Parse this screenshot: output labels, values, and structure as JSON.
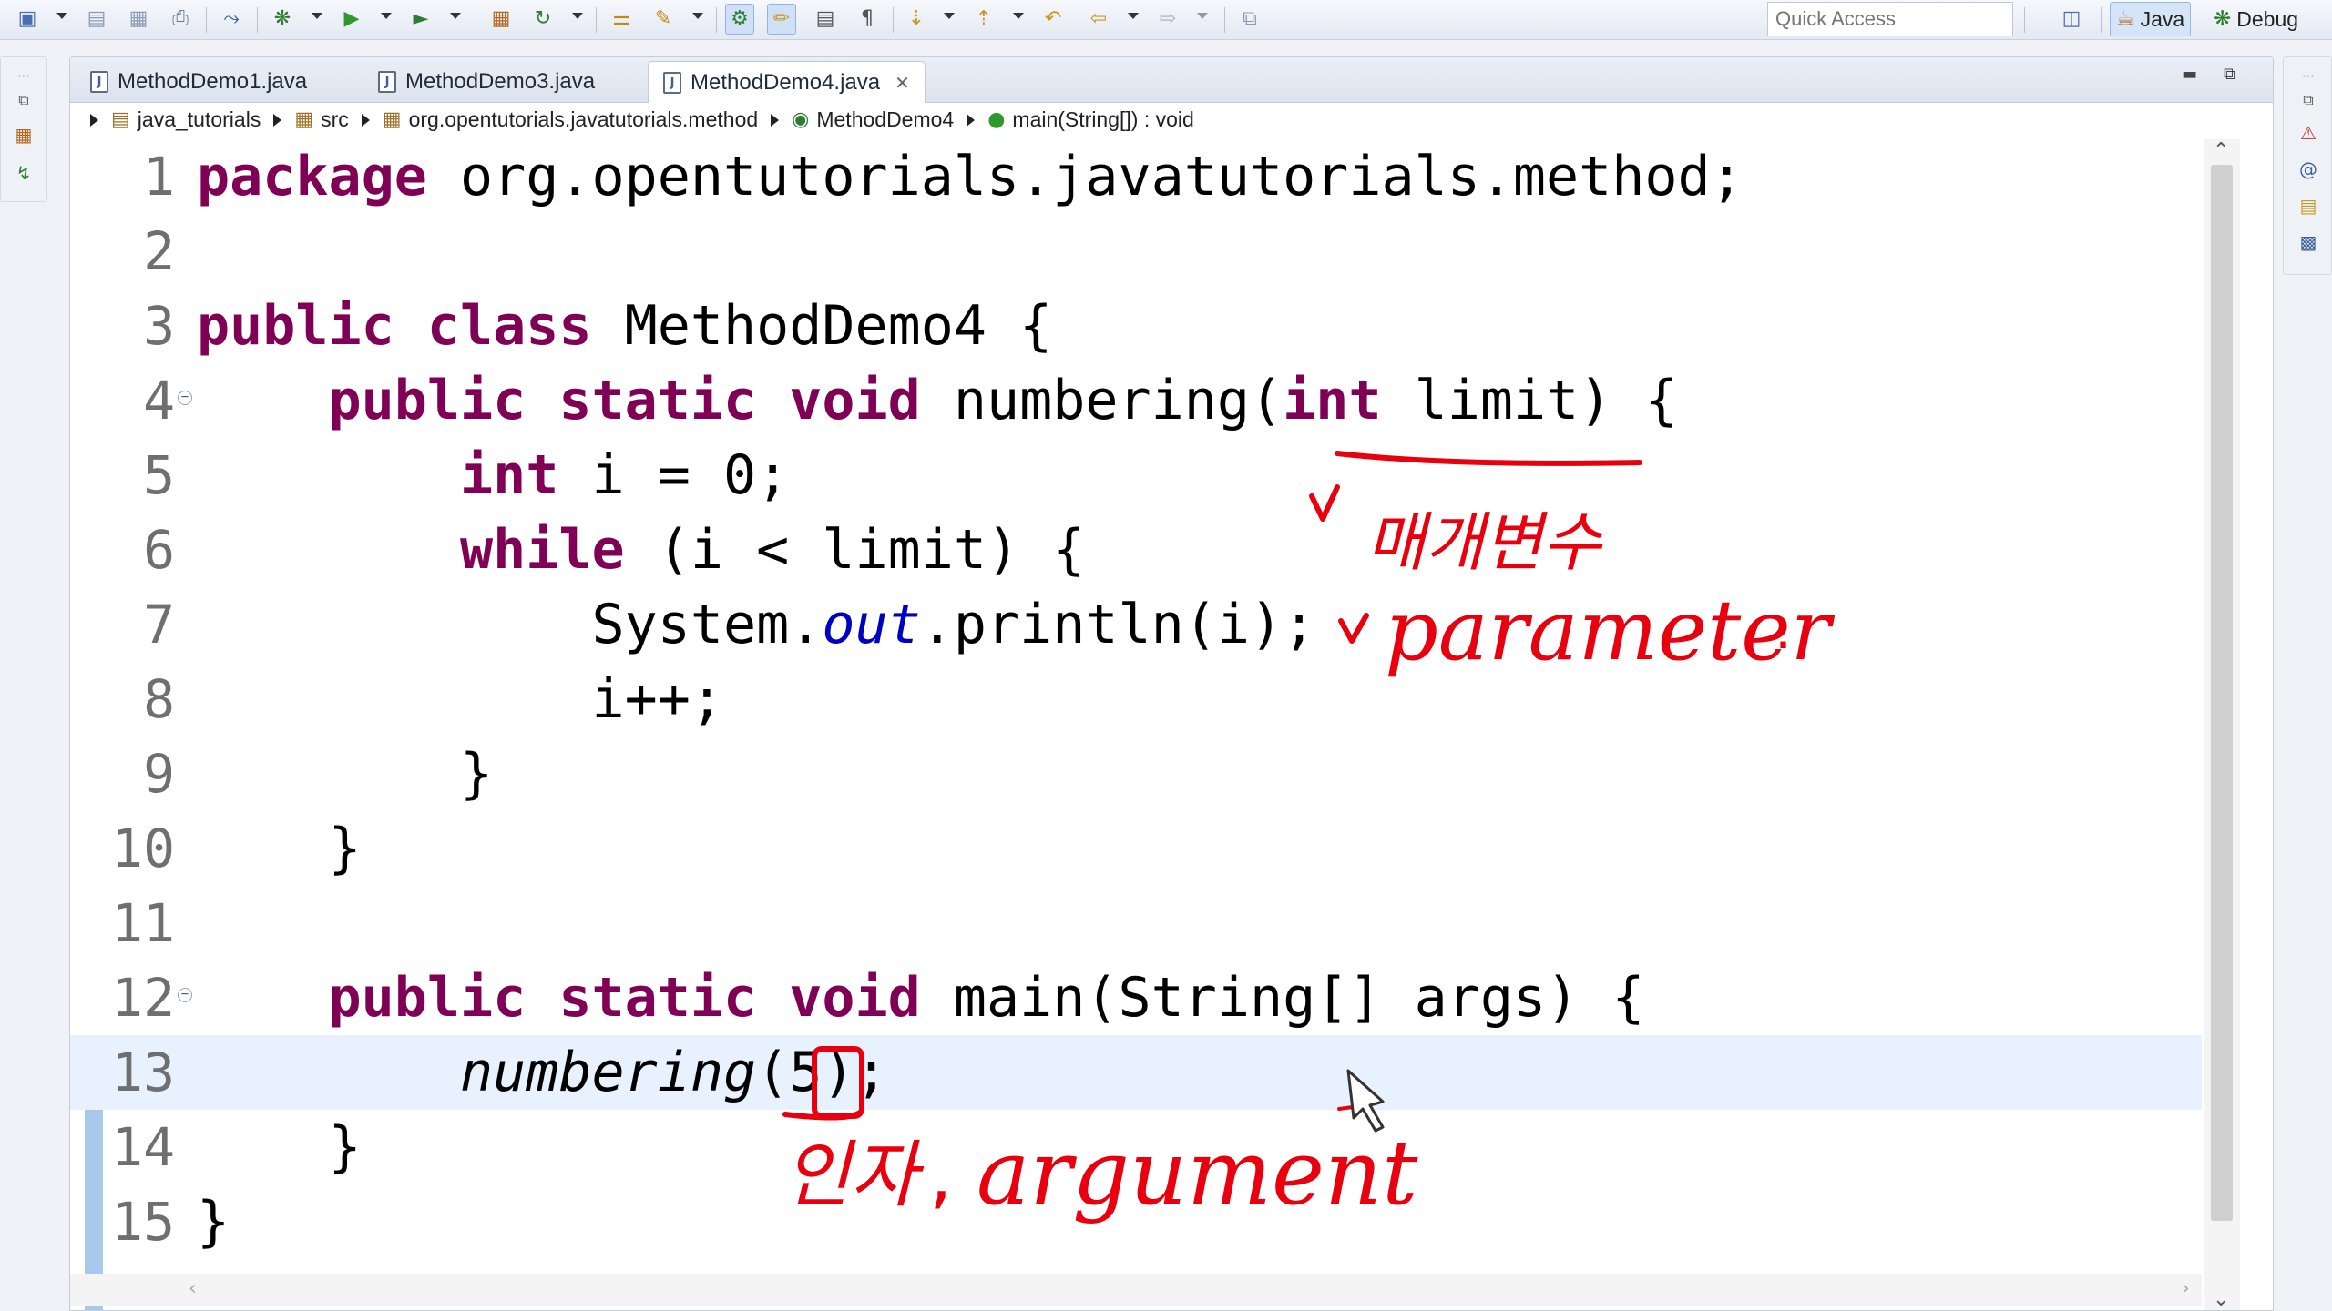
{
  "toolbar": {
    "quick_access_placeholder": "Quick Access",
    "perspectives": [
      {
        "label": "Java",
        "icon": "java-perspective-icon"
      },
      {
        "label": "Debug",
        "icon": "debug-perspective-icon"
      }
    ]
  },
  "editor": {
    "tabs": [
      {
        "label": "MethodDemo1.java"
      },
      {
        "label": "MethodDemo3.java"
      },
      {
        "label": "MethodDemo4.java",
        "active": true
      }
    ],
    "breadcrumb": [
      {
        "label": "java_tutorials",
        "icon": "project-icon"
      },
      {
        "label": "src",
        "icon": "source-folder-icon"
      },
      {
        "label": "org.opentutorials.javatutorials.method",
        "icon": "package-icon"
      },
      {
        "label": "MethodDemo4",
        "icon": "class-icon"
      },
      {
        "label": "main(String[]) : void",
        "icon": "method-icon"
      }
    ],
    "code_lines": [
      {
        "n": "1",
        "text": "package org.opentutorials.javatutorials.method;"
      },
      {
        "n": "2",
        "text": ""
      },
      {
        "n": "3",
        "text": "public class MethodDemo4 {"
      },
      {
        "n": "4",
        "text": "    public static void numbering(int limit) {"
      },
      {
        "n": "5",
        "text": "        int i = 0;"
      },
      {
        "n": "6",
        "text": "        while (i < limit) {"
      },
      {
        "n": "7",
        "text": "            System.out.println(i);"
      },
      {
        "n": "8",
        "text": "            i++;"
      },
      {
        "n": "9",
        "text": "        }"
      },
      {
        "n": "10",
        "text": "    }"
      },
      {
        "n": "11",
        "text": ""
      },
      {
        "n": "12",
        "text": "    public static void main(String[] args) {"
      },
      {
        "n": "13",
        "text": "        numbering(5);"
      },
      {
        "n": "14",
        "text": "    }"
      },
      {
        "n": "15",
        "text": "}"
      }
    ],
    "current_line": 13
  },
  "annotations": {
    "param_label_korean": "매개변수",
    "param_label": "parameter",
    "arg_label_korean": "인자",
    "arg_label": "argument",
    "ink_color": "#e8000e"
  },
  "colors": {
    "keyword": "#7f0055",
    "field": "#0000c0",
    "current_line_bg": "#e8f2fe"
  }
}
